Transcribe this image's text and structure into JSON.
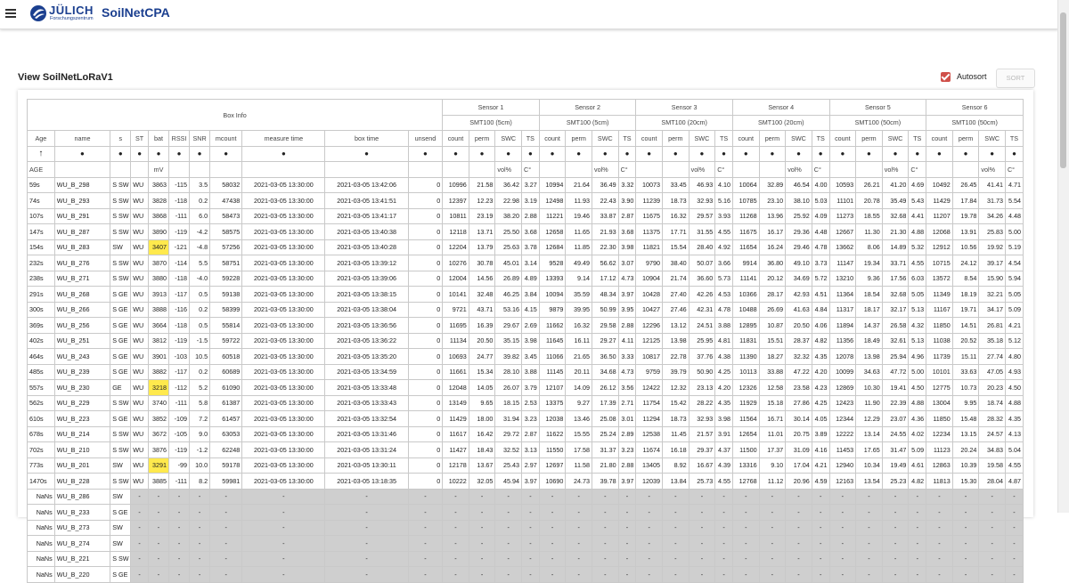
{
  "app": {
    "logo_name": "JÜLICH",
    "logo_sub": "Forschungszentrum",
    "title": "SoilNetCPA",
    "view_title": "View SoilNetLoRaV1",
    "autosort_label": "Autosort",
    "autosort_checked": true,
    "sort_label": "SORT"
  },
  "table": {
    "group_box": "Box Info",
    "sensors": [
      {
        "name": "Sensor 1",
        "model": "SMT100 (5cm)"
      },
      {
        "name": "Sensor 2",
        "model": "SMT100 (5cm)"
      },
      {
        "name": "Sensor 3",
        "model": "SMT100 (20cm)"
      },
      {
        "name": "Sensor 4",
        "model": "SMT100 (20cm)"
      },
      {
        "name": "Sensor 5",
        "model": "SMT100 (50cm)"
      },
      {
        "name": "Sensor 6",
        "model": "SMT100 (50cm)"
      }
    ],
    "box_columns": [
      "Age",
      "name",
      "s",
      "ST",
      "bat",
      "RSSI",
      "SNR",
      "mcount",
      "measure time",
      "box time",
      "unsend"
    ],
    "sensor_columns": [
      "count",
      "perm",
      "SWC",
      "TS"
    ],
    "sort_arrow": "↑",
    "filter_dot": "●",
    "units_box": [
      "AGE",
      "",
      "",
      "",
      "mV",
      "",
      "",
      "",
      "",
      "",
      ""
    ],
    "units_sensor": [
      "",
      "",
      "vol%",
      "C°"
    ],
    "highlight_color": "#ffe94d",
    "rows": [
      [
        "59s",
        "WU_B_298",
        "S SW",
        "WU",
        "3863",
        "-115",
        "3.5",
        "58032",
        "2021-03-05 13:30:00",
        "2021-03-05 13:42:06",
        "0",
        "10996",
        "21.58",
        "36.42",
        "3.27",
        "10994",
        "21.64",
        "36.49",
        "3.32",
        "10073",
        "33.45",
        "46.93",
        "4.10",
        "10064",
        "32.89",
        "46.54",
        "4.00",
        "10593",
        "26.21",
        "41.20",
        "4.69",
        "10492",
        "26.45",
        "41.41",
        "4.71"
      ],
      [
        "74s",
        "WU_B_293",
        "S SW",
        "WU",
        "3828",
        "-118",
        "0.2",
        "47438",
        "2021-03-05 13:30:00",
        "2021-03-05 13:41:51",
        "0",
        "12397",
        "12.23",
        "22.98",
        "3.19",
        "12498",
        "11.93",
        "22.43",
        "3.90",
        "11239",
        "18.73",
        "32.93",
        "5.16",
        "10785",
        "23.10",
        "38.10",
        "5.03",
        "11101",
        "20.78",
        "35.49",
        "5.43",
        "11429",
        "17.84",
        "31.73",
        "5.54"
      ],
      [
        "107s",
        "WU_B_291",
        "S SW",
        "WU",
        "3868",
        "-111",
        "6.0",
        "58473",
        "2021-03-05 13:30:00",
        "2021-03-05 13:41:17",
        "0",
        "10811",
        "23.19",
        "38.20",
        "2.88",
        "11221",
        "19.46",
        "33.87",
        "2.87",
        "11675",
        "16.32",
        "29.57",
        "3.93",
        "11268",
        "13.96",
        "25.92",
        "4.09",
        "11273",
        "18.55",
        "32.68",
        "4.41",
        "11207",
        "19.78",
        "34.26",
        "4.48"
      ],
      [
        "147s",
        "WU_B_287",
        "S SW",
        "WU",
        "3890",
        "-119",
        "-4.2",
        "58575",
        "2021-03-05 13:30:00",
        "2021-03-05 13:40:38",
        "0",
        "12118",
        "13.71",
        "25.50",
        "3.68",
        "12658",
        "11.65",
        "21.93",
        "3.68",
        "11375",
        "17.71",
        "31.55",
        "4.55",
        "11675",
        "16.17",
        "29.36",
        "4.48",
        "12667",
        "11.30",
        "21.30",
        "4.88",
        "12068",
        "13.91",
        "25.83",
        "5.00"
      ],
      [
        "154s",
        "WU_B_283",
        "SW",
        "WU",
        "3407",
        "-121",
        "-4.8",
        "57256",
        "2021-03-05 13:30:00",
        "2021-03-05 13:40:28",
        "0",
        "12204",
        "13.79",
        "25.63",
        "3.78",
        "12684",
        "11.85",
        "22.30",
        "3.98",
        "11821",
        "15.54",
        "28.40",
        "4.92",
        "11654",
        "16.24",
        "29.46",
        "4.78",
        "13662",
        "8.06",
        "14.89",
        "5.32",
        "12912",
        "10.56",
        "19.92",
        "5.19"
      ],
      [
        "232s",
        "WU_B_276",
        "S SW",
        "WU",
        "3870",
        "-114",
        "5.5",
        "58751",
        "2021-03-05 13:30:00",
        "2021-03-05 13:39:12",
        "0",
        "10276",
        "30.78",
        "45.01",
        "3.14",
        "9528",
        "49.49",
        "56.62",
        "3.07",
        "9790",
        "38.40",
        "50.07",
        "3.66",
        "9914",
        "36.80",
        "49.10",
        "3.73",
        "11147",
        "19.34",
        "33.71",
        "4.55",
        "10715",
        "24.12",
        "39.17",
        "4.54"
      ],
      [
        "238s",
        "WU_B_271",
        "S SW",
        "WU",
        "3880",
        "-118",
        "-4.0",
        "59228",
        "2021-03-05 13:30:00",
        "2021-03-05 13:39:06",
        "0",
        "12004",
        "14.56",
        "26.89",
        "4.89",
        "13393",
        "9.14",
        "17.12",
        "4.73",
        "10904",
        "21.74",
        "36.60",
        "5.73",
        "11141",
        "20.12",
        "34.69",
        "5.72",
        "13210",
        "9.36",
        "17.56",
        "6.03",
        "13572",
        "8.54",
        "15.90",
        "5.94"
      ],
      [
        "291s",
        "WU_B_268",
        "S GE",
        "WU",
        "3913",
        "-117",
        "0.5",
        "59138",
        "2021-03-05 13:30:00",
        "2021-03-05 13:38:15",
        "0",
        "10141",
        "32.48",
        "46.25",
        "3.84",
        "10094",
        "35.59",
        "48.34",
        "3.97",
        "10428",
        "27.40",
        "42.26",
        "4.53",
        "10366",
        "28.17",
        "42.93",
        "4.51",
        "11364",
        "18.54",
        "32.68",
        "5.05",
        "11349",
        "18.19",
        "32.21",
        "5.05"
      ],
      [
        "300s",
        "WU_B_266",
        "S GE",
        "WU",
        "3888",
        "-116",
        "0.2",
        "58399",
        "2021-03-05 13:30:00",
        "2021-03-05 13:38:04",
        "0",
        "9721",
        "43.71",
        "53.16",
        "4.15",
        "9879",
        "39.95",
        "50.99",
        "3.95",
        "10427",
        "27.46",
        "42.31",
        "4.78",
        "10488",
        "26.69",
        "41.63",
        "4.84",
        "11317",
        "18.17",
        "32.17",
        "5.13",
        "11167",
        "19.71",
        "34.17",
        "5.09"
      ],
      [
        "369s",
        "WU_B_256",
        "S GE",
        "WU",
        "3664",
        "-118",
        "0.5",
        "55814",
        "2021-03-05 13:30:00",
        "2021-03-05 13:36:56",
        "0",
        "11695",
        "16.39",
        "29.67",
        "2.69",
        "11662",
        "16.32",
        "29.58",
        "2.88",
        "12296",
        "13.12",
        "24.51",
        "3.88",
        "12895",
        "10.87",
        "20.50",
        "4.06",
        "11894",
        "14.37",
        "26.58",
        "4.32",
        "11850",
        "14.51",
        "26.81",
        "4.21"
      ],
      [
        "402s",
        "WU_B_251",
        "S GE",
        "WU",
        "3812",
        "-119",
        "-1.5",
        "59722",
        "2021-03-05 13:30:00",
        "2021-03-05 13:36:22",
        "0",
        "11134",
        "20.50",
        "35.15",
        "3.98",
        "11645",
        "16.11",
        "29.27",
        "4.11",
        "12125",
        "13.98",
        "25.95",
        "4.81",
        "11831",
        "15.51",
        "28.37",
        "4.82",
        "11356",
        "18.49",
        "32.61",
        "5.13",
        "11038",
        "20.52",
        "35.18",
        "5.12"
      ],
      [
        "464s",
        "WU_B_243",
        "S GE",
        "WU",
        "3901",
        "-103",
        "10.5",
        "60518",
        "2021-03-05 13:30:00",
        "2021-03-05 13:35:20",
        "0",
        "10693",
        "24.77",
        "39.82",
        "3.45",
        "11066",
        "21.65",
        "36.50",
        "3.33",
        "10817",
        "22.78",
        "37.76",
        "4.38",
        "11390",
        "18.27",
        "32.32",
        "4.35",
        "12078",
        "13.98",
        "25.94",
        "4.96",
        "11739",
        "15.11",
        "27.74",
        "4.80"
      ],
      [
        "485s",
        "WU_B_239",
        "S GE",
        "WU",
        "3882",
        "-117",
        "0.2",
        "60689",
        "2021-03-05 13:30:00",
        "2021-03-05 13:34:59",
        "0",
        "11661",
        "15.34",
        "28.10",
        "3.88",
        "11145",
        "20.11",
        "34.68",
        "4.73",
        "9759",
        "39.79",
        "50.90",
        "4.25",
        "10113",
        "33.88",
        "47.22",
        "4.20",
        "10099",
        "34.63",
        "47.72",
        "5.00",
        "10101",
        "33.63",
        "47.05",
        "4.93"
      ],
      [
        "557s",
        "WU_B_230",
        "GE",
        "WU",
        "3218",
        "-112",
        "5.2",
        "61090",
        "2021-03-05 13:30:00",
        "2021-03-05 13:33:48",
        "0",
        "12048",
        "14.05",
        "26.07",
        "3.79",
        "12107",
        "14.09",
        "26.12",
        "3.56",
        "12422",
        "12.32",
        "23.13",
        "4.20",
        "12326",
        "12.58",
        "23.58",
        "4.23",
        "12869",
        "10.30",
        "19.41",
        "4.50",
        "12775",
        "10.73",
        "20.23",
        "4.50"
      ],
      [
        "562s",
        "WU_B_229",
        "S SW",
        "WU",
        "3740",
        "-111",
        "5.8",
        "61387",
        "2021-03-05 13:30:00",
        "2021-03-05 13:33:43",
        "0",
        "13149",
        "9.65",
        "18.15",
        "2.53",
        "13375",
        "9.27",
        "17.39",
        "2.71",
        "11754",
        "15.42",
        "28.22",
        "4.35",
        "11929",
        "15.18",
        "27.86",
        "4.25",
        "12423",
        "11.90",
        "22.39",
        "4.88",
        "13004",
        "9.95",
        "18.74",
        "4.88"
      ],
      [
        "610s",
        "WU_B_223",
        "S GE",
        "WU",
        "3852",
        "-109",
        "7.2",
        "61457",
        "2021-03-05 13:30:00",
        "2021-03-05 13:32:54",
        "0",
        "11429",
        "18.00",
        "31.94",
        "3.23",
        "12038",
        "13.46",
        "25.08",
        "3.01",
        "11294",
        "18.73",
        "32.93",
        "3.98",
        "11564",
        "16.71",
        "30.14",
        "4.05",
        "12344",
        "12.29",
        "23.07",
        "4.36",
        "11850",
        "15.48",
        "28.32",
        "4.35"
      ],
      [
        "678s",
        "WU_B_214",
        "S SW",
        "WU",
        "3672",
        "-105",
        "9.0",
        "63053",
        "2021-03-05 13:30:00",
        "2021-03-05 13:31:46",
        "0",
        "11617",
        "16.42",
        "29.72",
        "2.87",
        "11622",
        "15.55",
        "25.24",
        "2.89",
        "12538",
        "11.45",
        "21.57",
        "3.91",
        "12654",
        "11.01",
        "20.75",
        "3.89",
        "12222",
        "13.14",
        "24.55",
        "4.02",
        "12234",
        "13.15",
        "24.57",
        "4.13"
      ],
      [
        "702s",
        "WU_B_210",
        "S SW",
        "WU",
        "3876",
        "-119",
        "-1.2",
        "62248",
        "2021-03-05 13:30:00",
        "2021-03-05 13:31:24",
        "0",
        "11427",
        "18.43",
        "32.52",
        "3.13",
        "11550",
        "17.58",
        "31.37",
        "3.23",
        "11674",
        "16.18",
        "29.37",
        "4.37",
        "11500",
        "17.37",
        "31.09",
        "4.16",
        "11453",
        "17.65",
        "31.47",
        "5.09",
        "11123",
        "20.24",
        "34.83",
        "5.04"
      ],
      [
        "773s",
        "WU_B_201",
        "SW",
        "WU",
        "3291",
        "-99",
        "10.0",
        "59178",
        "2021-03-05 13:30:00",
        "2021-03-05 13:30:11",
        "0",
        "12178",
        "13.67",
        "25.43",
        "2.97",
        "12697",
        "11.58",
        "21.80",
        "2.88",
        "13405",
        "8.92",
        "16.67",
        "4.39",
        "13316",
        "9.10",
        "17.04",
        "4.21",
        "12940",
        "10.34",
        "19.49",
        "4.61",
        "12863",
        "10.39",
        "19.58",
        "4.55"
      ],
      [
        "1470s",
        "WU_B_228",
        "S SW",
        "WU",
        "3885",
        "-111",
        "8.2",
        "59981",
        "2021-03-05 13:30:00",
        "2021-03-05 13:18:35",
        "0",
        "10222",
        "32.05",
        "45.94",
        "3.97",
        "10690",
        "24.73",
        "39.78",
        "3.97",
        "12039",
        "13.84",
        "25.73",
        "4.55",
        "12768",
        "11.12",
        "20.96",
        "4.59",
        "12163",
        "13.54",
        "25.23",
        "4.82",
        "11813",
        "15.30",
        "28.04",
        "4.87"
      ]
    ],
    "highlight_rows": [
      4,
      13,
      18
    ],
    "nan_rows": [
      [
        "NaNs",
        "WU_B_286",
        "SW"
      ],
      [
        "NaNs",
        "WU_B_233",
        "S GE"
      ],
      [
        "NaNs",
        "WU_B_273",
        "SW"
      ],
      [
        "NaNs",
        "WU_B_274",
        "SW"
      ],
      [
        "NaNs",
        "WU_B_221",
        "S SW"
      ],
      [
        "NaNs",
        "WU_B_220",
        "S GE"
      ]
    ],
    "nan_value": "-"
  }
}
